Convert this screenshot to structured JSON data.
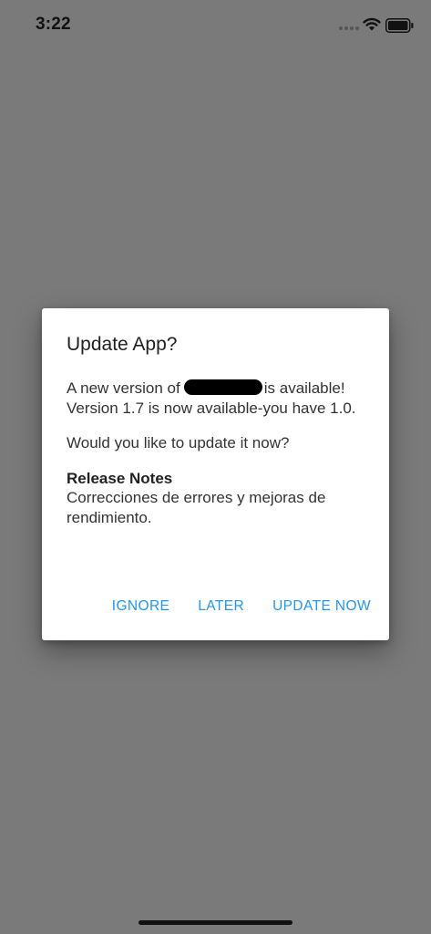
{
  "status_bar": {
    "time": "3:22",
    "icons": [
      "cellular-signal-icon",
      "wifi-icon",
      "battery-icon"
    ]
  },
  "dialog": {
    "title": "Update App?",
    "message_prefix": "A new version of",
    "message_suffix": "is available! Version 1.7 is now available-you have 1.0.",
    "prompt": "Would you like to update it now?",
    "release_notes_heading": "Release Notes",
    "release_notes_text": "Correcciones de errores y mejoras de rendimiento.",
    "actions": {
      "ignore": "IGNORE",
      "later": "LATER",
      "update_now": "UPDATE NOW"
    }
  },
  "colors": {
    "scrim": "#7a7a7a",
    "dialog_background": "#ffffff",
    "accent": "#2196f3",
    "title_text": "#212121",
    "body_text": "#333333"
  }
}
